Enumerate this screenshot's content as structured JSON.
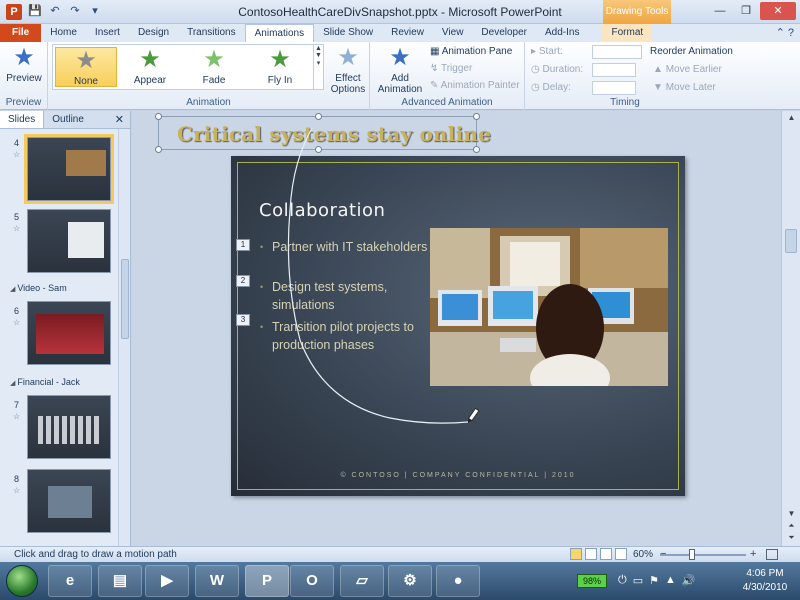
{
  "titlebar": {
    "title": "ContosoHealthCareDivSnapshot.pptx - Microsoft PowerPoint",
    "contextual": "Drawing Tools",
    "app_letter": "P",
    "min": "—",
    "max": "❐",
    "close": "✕"
  },
  "tabs": {
    "file": "File",
    "items": [
      "Home",
      "Insert",
      "Design",
      "Transitions",
      "Animations",
      "Slide Show",
      "Review",
      "View",
      "Developer",
      "Add-Ins"
    ],
    "format": "Format"
  },
  "ribbon": {
    "preview": {
      "label": "Preview",
      "group": "Preview"
    },
    "animation": {
      "group": "Animation",
      "items": [
        "None",
        "Appear",
        "Fade",
        "Fly In"
      ],
      "effect_options": "Effect Options"
    },
    "advanced": {
      "group": "Advanced Animation",
      "add_animation": "Add Animation",
      "animation_pane": "Animation Pane",
      "trigger": "Trigger",
      "animation_painter": "Animation Painter"
    },
    "timing": {
      "group": "Timing",
      "start": "Start:",
      "duration": "Duration:",
      "delay": "Delay:",
      "reorder": "Reorder Animation",
      "move_earlier": "Move Earlier",
      "move_later": "Move Later"
    }
  },
  "leftpane": {
    "tab_slides": "Slides",
    "tab_outline": "Outline",
    "close": "✕",
    "slides": [
      {
        "num": "4"
      },
      {
        "num": "5"
      },
      {
        "num": "6"
      },
      {
        "num": "7"
      },
      {
        "num": "8"
      }
    ],
    "sections": [
      "Video - Sam",
      "Financial - Jack"
    ]
  },
  "slide": {
    "title_box": "Critical systems stay online",
    "heading": "Collaboration",
    "bullets": [
      {
        "tag": "1",
        "text": "Partner with IT stakeholders"
      },
      {
        "tag": "2",
        "text": "Design test systems, simulations"
      },
      {
        "tag": "3",
        "text": "Transition pilot projects to production phases"
      }
    ],
    "footer": "© CONTOSO  |  COMPANY CONFIDENTIAL  |  2010"
  },
  "statusbar": {
    "message": "Click and drag to draw a motion path",
    "zoom": "60%"
  },
  "taskbar": {
    "apps": [
      {
        "icon": "internet-explorer-icon",
        "glyph": "e"
      },
      {
        "icon": "folder-icon",
        "glyph": "▤"
      },
      {
        "icon": "media-player-icon",
        "glyph": "▶"
      },
      {
        "icon": "word-icon",
        "glyph": "W"
      },
      {
        "icon": "powerpoint-icon",
        "glyph": "P"
      },
      {
        "icon": "outlook-icon",
        "glyph": "O"
      },
      {
        "icon": "notes-icon",
        "glyph": "▱"
      },
      {
        "icon": "control-panel-icon",
        "glyph": "⚙"
      },
      {
        "icon": "camera-icon",
        "glyph": "●"
      }
    ],
    "battery": "98%",
    "time": "4:06 PM",
    "date": "4/30/2010"
  },
  "colors": {
    "accent": "#d2491c",
    "selected": "#f8cf5a",
    "title_gold": "#c7b35b"
  }
}
